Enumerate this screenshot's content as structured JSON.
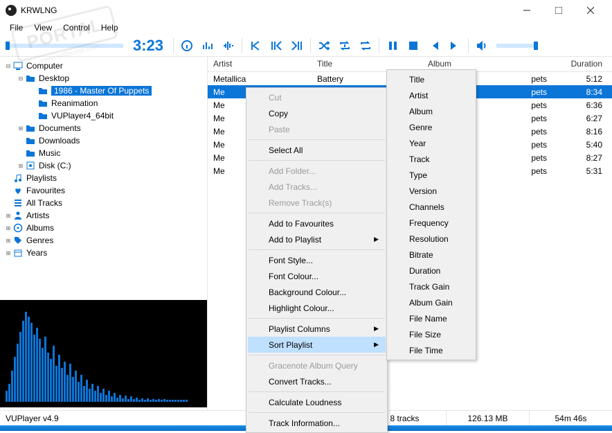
{
  "window": {
    "title": "KRWLNG"
  },
  "menu": {
    "file": "File",
    "view": "View",
    "control": "Control",
    "help": "Help"
  },
  "time": "3:23",
  "tree": [
    {
      "indent": 0,
      "twist": "⊟",
      "icon": "computer",
      "label": "Computer"
    },
    {
      "indent": 1,
      "twist": "⊟",
      "icon": "folder",
      "label": "Desktop"
    },
    {
      "indent": 2,
      "twist": "",
      "icon": "folder",
      "label": "1986 - Master Of Puppets",
      "sel": true
    },
    {
      "indent": 2,
      "twist": "",
      "icon": "folder",
      "label": "Reanimation"
    },
    {
      "indent": 2,
      "twist": "",
      "icon": "folder",
      "label": "VUPlayer4_64bit"
    },
    {
      "indent": 1,
      "twist": "⊞",
      "icon": "folder",
      "label": "Documents"
    },
    {
      "indent": 1,
      "twist": "",
      "icon": "folder",
      "label": "Downloads"
    },
    {
      "indent": 1,
      "twist": "",
      "icon": "folder",
      "label": "Music"
    },
    {
      "indent": 1,
      "twist": "⊞",
      "icon": "disk",
      "label": "Disk (C:)"
    },
    {
      "indent": 0,
      "twist": "",
      "icon": "note",
      "label": "Playlists"
    },
    {
      "indent": 0,
      "twist": "",
      "icon": "heart",
      "label": "Favourites"
    },
    {
      "indent": 0,
      "twist": "",
      "icon": "list",
      "label": "All Tracks"
    },
    {
      "indent": 0,
      "twist": "⊞",
      "icon": "person",
      "label": "Artists"
    },
    {
      "indent": 0,
      "twist": "⊞",
      "icon": "album",
      "label": "Albums"
    },
    {
      "indent": 0,
      "twist": "⊞",
      "icon": "tag",
      "label": "Genres"
    },
    {
      "indent": 0,
      "twist": "⊞",
      "icon": "cal",
      "label": "Years"
    }
  ],
  "cols": {
    "artist": "Artist",
    "title": "Title",
    "album": "Album",
    "duration": "Duration"
  },
  "tracks": [
    {
      "artist": "Metallica",
      "title": "Battery",
      "album": "pets",
      "dur": "5:12"
    },
    {
      "artist": "Me",
      "title": "",
      "album": "pets",
      "dur": "8:34",
      "sel": true
    },
    {
      "artist": "Me",
      "title": "",
      "album": "pets",
      "dur": "6:36"
    },
    {
      "artist": "Me",
      "title": "",
      "album": "pets",
      "dur": "6:27"
    },
    {
      "artist": "Me",
      "title": "",
      "album": "pets",
      "dur": "8:16"
    },
    {
      "artist": "Me",
      "title": "",
      "album": "pets",
      "dur": "5:40"
    },
    {
      "artist": "Me",
      "title": "",
      "album": "pets",
      "dur": "8:27"
    },
    {
      "artist": "Me",
      "title": "",
      "album": "pets",
      "dur": "5:31"
    }
  ],
  "ctx1": [
    {
      "t": "Cut",
      "d": true
    },
    {
      "t": "Copy"
    },
    {
      "t": "Paste",
      "d": true
    },
    {
      "sep": true
    },
    {
      "t": "Select All"
    },
    {
      "sep": true
    },
    {
      "t": "Add Folder...",
      "d": true
    },
    {
      "t": "Add Tracks...",
      "d": true
    },
    {
      "t": "Remove Track(s)",
      "d": true
    },
    {
      "sep": true
    },
    {
      "t": "Add to Favourites"
    },
    {
      "t": "Add to Playlist",
      "sub": true
    },
    {
      "sep": true
    },
    {
      "t": "Font Style..."
    },
    {
      "t": "Font Colour..."
    },
    {
      "t": "Background Colour..."
    },
    {
      "t": "Highlight Colour..."
    },
    {
      "sep": true
    },
    {
      "t": "Playlist Columns",
      "sub": true
    },
    {
      "t": "Sort Playlist",
      "sub": true,
      "hover": true
    },
    {
      "sep": true
    },
    {
      "t": "Gracenote Album Query",
      "d": true
    },
    {
      "t": "Convert Tracks..."
    },
    {
      "sep": true
    },
    {
      "t": "Calculate Loudness"
    },
    {
      "sep": true
    },
    {
      "t": "Track Information..."
    }
  ],
  "ctx2": [
    {
      "t": "Title"
    },
    {
      "t": "Artist"
    },
    {
      "t": "Album"
    },
    {
      "t": "Genre"
    },
    {
      "t": "Year"
    },
    {
      "t": "Track"
    },
    {
      "t": "Type"
    },
    {
      "t": "Version"
    },
    {
      "t": "Channels"
    },
    {
      "t": "Frequency"
    },
    {
      "t": "Resolution"
    },
    {
      "t": "Bitrate"
    },
    {
      "t": "Duration"
    },
    {
      "t": "Track Gain"
    },
    {
      "t": "Album Gain"
    },
    {
      "t": "File Name"
    },
    {
      "t": "File Size"
    },
    {
      "t": "File Time"
    }
  ],
  "status": {
    "app": "VUPlayer v4.9",
    "tracks": "8 tracks",
    "size": "126.13 MB",
    "time": "54m 46s"
  },
  "watermark": {
    "text": "PORTAL",
    "sub": "www.softportal.com"
  },
  "vis_bars": [
    12,
    20,
    35,
    50,
    65,
    78,
    90,
    100,
    95,
    88,
    75,
    82,
    70,
    60,
    72,
    55,
    48,
    62,
    40,
    52,
    38,
    45,
    30,
    42,
    28,
    35,
    22,
    30,
    18,
    25,
    15,
    20,
    12,
    18,
    10,
    15,
    8,
    12,
    6,
    10,
    5,
    8,
    4,
    7,
    3,
    6,
    3,
    5,
    2,
    4,
    2,
    4,
    2,
    3,
    2,
    3,
    2,
    3,
    2,
    2,
    2,
    2,
    2,
    2,
    2,
    2
  ]
}
